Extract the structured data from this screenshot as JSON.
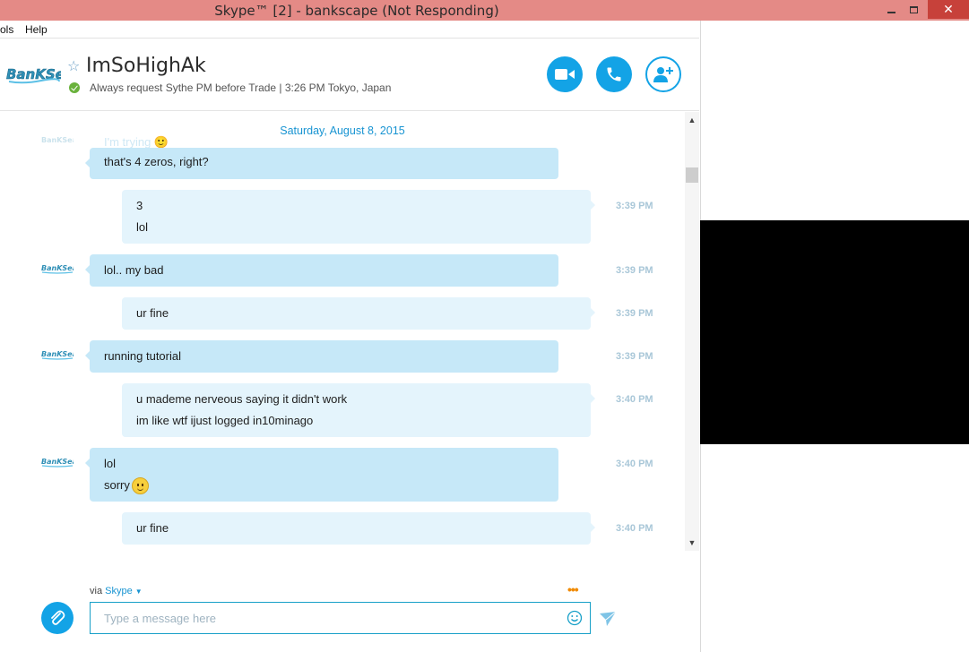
{
  "window": {
    "title": "Skype™ [2] - bankscape (Not Responding)",
    "close_glyph": "✕"
  },
  "menu": {
    "items": [
      "ols",
      "Help"
    ]
  },
  "header": {
    "contact_name": "ImSoHighAk",
    "mood": "Always request Sythe PM before Trade  |  3:26 PM Tokyo, Japan",
    "status": "online",
    "buttons": [
      "video-call",
      "voice-call",
      "add-contact"
    ]
  },
  "chat": {
    "date": "Saturday, August 8, 2015",
    "faded_text": "I'm trying 🙂",
    "messages": [
      {
        "dir": "in",
        "lines": [
          "that's 4 zeros, right?"
        ],
        "time": ""
      },
      {
        "dir": "out",
        "lines": [
          "3",
          "lol"
        ],
        "time": "3:39 PM"
      },
      {
        "dir": "in",
        "lines": [
          "lol.. my bad"
        ],
        "time": "3:39 PM"
      },
      {
        "dir": "out",
        "lines": [
          "ur fine"
        ],
        "time": "3:39 PM"
      },
      {
        "dir": "in",
        "lines": [
          "running tutorial"
        ],
        "time": "3:39 PM"
      },
      {
        "dir": "out",
        "lines": [
          "u mademe nerveous saying it didn't work",
          "im like wtf ijust logged in10minago"
        ],
        "time": "3:40 PM"
      },
      {
        "dir": "in",
        "lines": [
          "lol",
          "sorry"
        ],
        "time": "3:40 PM",
        "emoji_on_line": 1
      },
      {
        "dir": "out",
        "lines": [
          "ur fine"
        ],
        "time": "3:40 PM"
      }
    ]
  },
  "composer": {
    "via_label": "via",
    "via_link": "Skype",
    "placeholder": "Type a message here"
  },
  "colors": {
    "accent": "#13a3e6",
    "bubble_in": "#c6e8f8",
    "bubble_out": "#e4f4fc",
    "titlebar": "#e48a86"
  }
}
